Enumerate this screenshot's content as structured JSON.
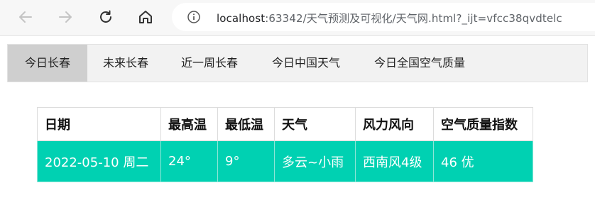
{
  "browser": {
    "url_host": "localhost",
    "url_rest": ":63342/天气预测及可视化/天气网.html?_ijt=vfcc38qvdtelc"
  },
  "tabs": [
    {
      "label": "今日长春",
      "active": true
    },
    {
      "label": "未来长春",
      "active": false
    },
    {
      "label": "近一周长春",
      "active": false
    },
    {
      "label": "今日中国天气",
      "active": false
    },
    {
      "label": "今日全国空气质量",
      "active": false
    }
  ],
  "table": {
    "headers": [
      "日期",
      "最高温",
      "最低温",
      "天气",
      "风力风向",
      "空气质量指数"
    ],
    "rows": [
      [
        "2022-05-10 周二",
        "24°",
        "9°",
        "多云~小雨",
        "西南风4级",
        "46 优"
      ]
    ]
  },
  "colors": {
    "row_highlight": "#00d1b2",
    "active_tab": "#cfcfcf"
  }
}
